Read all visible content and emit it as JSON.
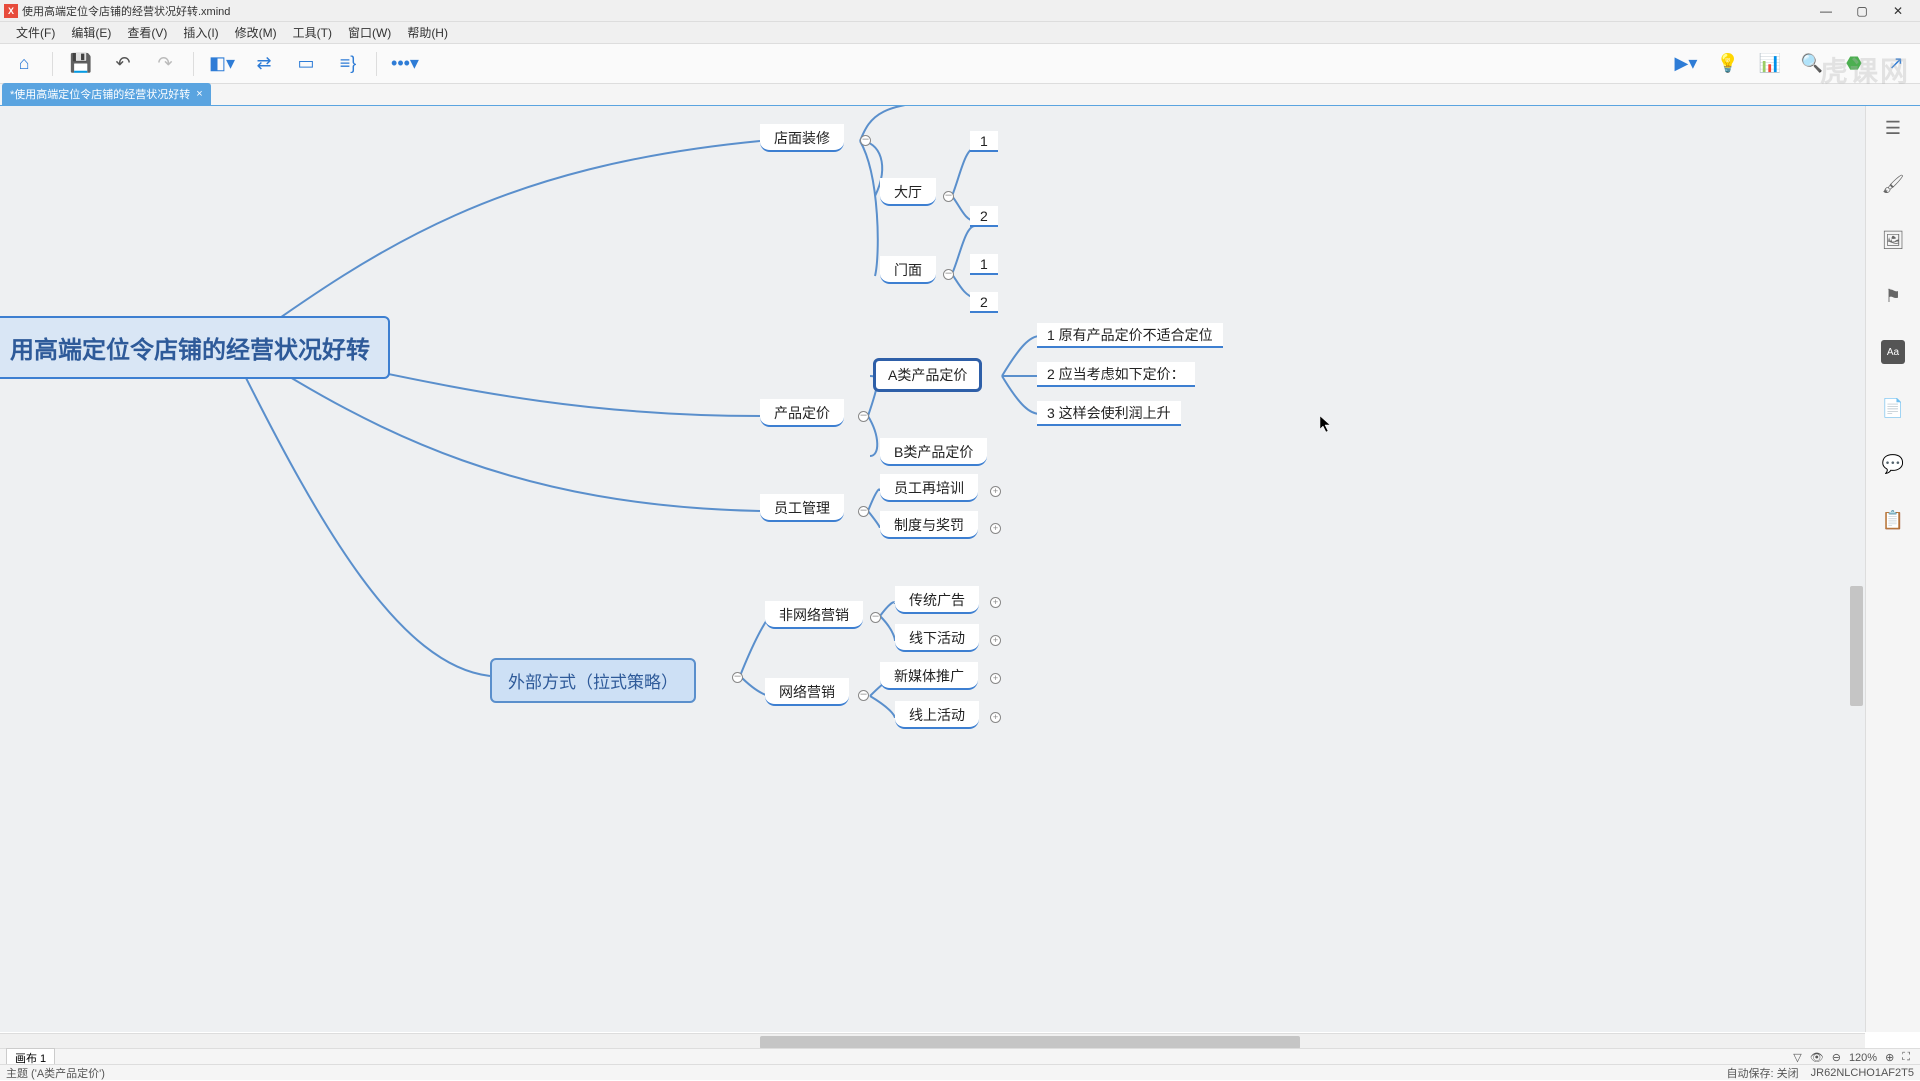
{
  "title": "使用高端定位令店铺的经营状况好转.xmind",
  "menu": {
    "file": "文件(F)",
    "edit": "编辑(E)",
    "view": "查看(V)",
    "insert": "插入(I)",
    "modify": "修改(M)",
    "tools": "工具(T)",
    "window": "窗口(W)",
    "help": "帮助(H)"
  },
  "tab": {
    "label": "*使用高端定位令店铺的经营状况好转"
  },
  "central": "用高端定位令店铺的经营状况好转",
  "nodes": {
    "decor": "店面装修",
    "hall": "大厅",
    "front": "门面",
    "n1": "1",
    "n2": "2",
    "pricing": "产品定价",
    "apricing": "A类产品定价",
    "bpricing": "B类产品定价",
    "a1": "1 原有产品定价不适合定位",
    "a2": "2 应当考虑如下定价：",
    "a3": "3 这样会使利润上升",
    "staff": "员工管理",
    "train": "员工再培训",
    "rule": "制度与奖罚",
    "external": "外部方式（拉式策略）",
    "offline": "非网络营销",
    "online": "网络营销",
    "trad": "传统广告",
    "act": "线下活动",
    "newmedia": "新媒体推广",
    "onlineact": "线上活动"
  },
  "sheet": "画布 1",
  "status": {
    "topic": "主题 ('A类产品定价')",
    "autosave": "自动保存: 关闭",
    "code": "JR62NLCHO1AF2T5"
  },
  "zoom": "120%",
  "watermark": "虎课网"
}
